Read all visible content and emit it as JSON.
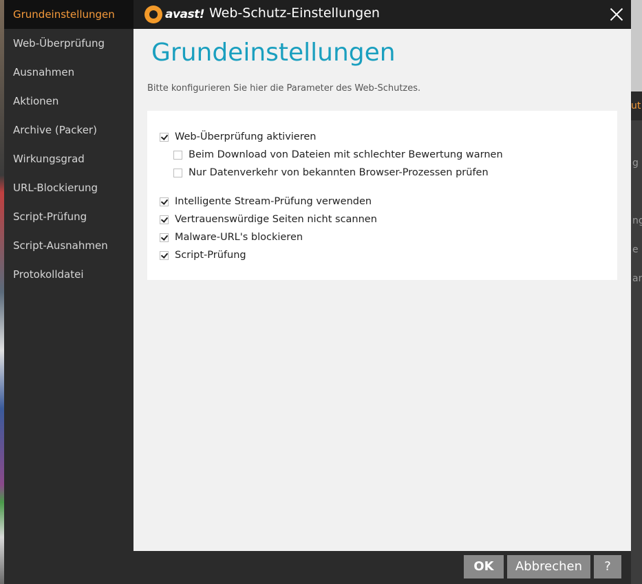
{
  "window": {
    "logo_text": "avast!",
    "title": "Web-Schutz-Einstellungen"
  },
  "sidebar": {
    "items": [
      {
        "label": "Grundeinstellungen",
        "active": true
      },
      {
        "label": "Web-Überprüfung"
      },
      {
        "label": "Ausnahmen"
      },
      {
        "label": "Aktionen"
      },
      {
        "label": "Archive (Packer)"
      },
      {
        "label": "Wirkungsgrad"
      },
      {
        "label": "URL-Blockierung"
      },
      {
        "label": "Script-Prüfung"
      },
      {
        "label": "Script-Ausnahmen"
      },
      {
        "label": "Protokolldatei"
      }
    ]
  },
  "main": {
    "title": "Grundeinstellungen",
    "description": "Bitte konfigurieren Sie hier die Parameter des Web-Schutzes.",
    "options": [
      {
        "label": "Web-Überprüfung aktivieren",
        "checked": true
      },
      {
        "label": "Beim Download von Dateien mit schlechter Bewertung warnen",
        "checked": false
      },
      {
        "label": "Nur Datenverkehr von bekannten Browser-Prozessen prüfen",
        "checked": false
      },
      {
        "label": "Intelligente Stream-Prüfung verwenden",
        "checked": true
      },
      {
        "label": "Vertrauenswürdige Seiten nicht scannen",
        "checked": true
      },
      {
        "label": "Malware-URL's blockieren",
        "checked": true
      },
      {
        "label": "Script-Prüfung",
        "checked": true
      }
    ]
  },
  "footer": {
    "ok_label": "OK",
    "cancel_label": "Abbrechen",
    "help_label": "?"
  },
  "background": {
    "right_text": [
      "ut",
      "g",
      "ng",
      "e",
      "and"
    ]
  },
  "colors": {
    "accent_orange": "#f59a3b",
    "title_blue": "#1a9fbf",
    "sidebar_bg": "#2b2b2b",
    "button_gray": "#8a8a8a"
  }
}
